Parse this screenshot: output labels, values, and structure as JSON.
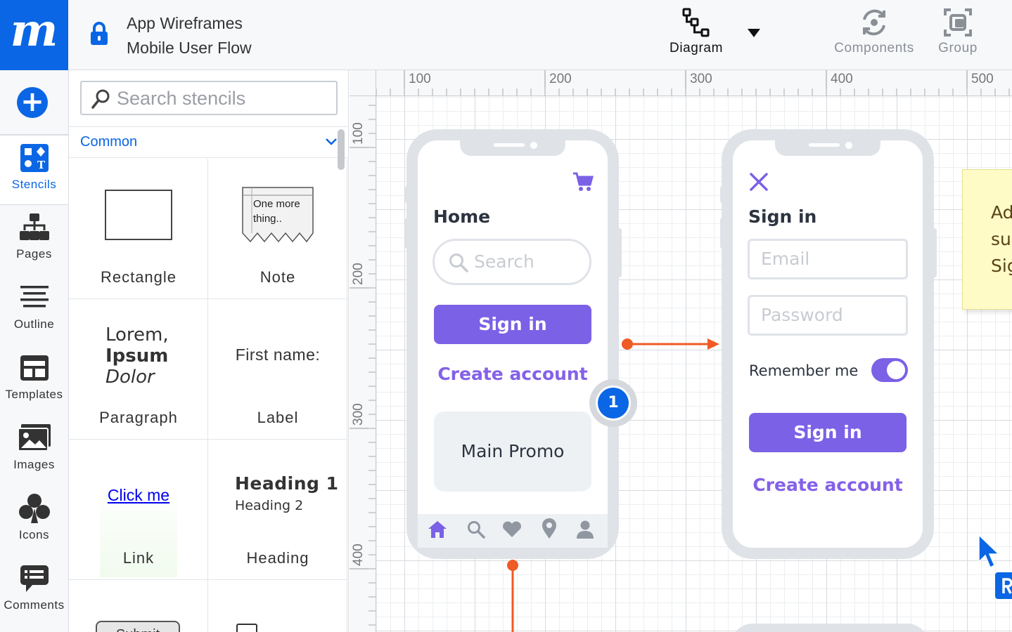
{
  "app": {
    "logo_letter": "m",
    "doc_title_line1": "App Wireframes",
    "doc_title_line2": "Mobile User Flow"
  },
  "toolbar": {
    "diagram": "Diagram",
    "components": "Components",
    "group": "Group"
  },
  "rail": {
    "add": "+",
    "items": [
      {
        "label": "Stencils",
        "icon": "stencils-icon",
        "active": true
      },
      {
        "label": "Pages",
        "icon": "pages-icon"
      },
      {
        "label": "Outline",
        "icon": "outline-icon"
      },
      {
        "label": "Templates",
        "icon": "templates-icon"
      },
      {
        "label": "Images",
        "icon": "images-icon"
      },
      {
        "label": "Icons",
        "icon": "club-icon"
      },
      {
        "label": "Comments",
        "icon": "comments-icon"
      }
    ]
  },
  "stencils": {
    "search_placeholder": "Search stencils",
    "section": "Common",
    "items": [
      {
        "label": "Rectangle"
      },
      {
        "label": "Note",
        "preview1": "One more",
        "preview2": "thing.."
      },
      {
        "label": "Paragraph",
        "preview1": "Lorem,",
        "preview2": "Ipsum",
        "preview3": "Dolor"
      },
      {
        "label": "Label",
        "preview": "First name:"
      },
      {
        "label": "Link",
        "preview": "Click me"
      },
      {
        "label": "Heading",
        "preview1": "Heading 1",
        "preview2": "Heading 2"
      }
    ],
    "partial_button": "Submit"
  },
  "rulers": {
    "top": [
      "100",
      "200",
      "300",
      "400",
      "500"
    ],
    "left": [
      "100",
      "200",
      "300",
      "400"
    ]
  },
  "home_screen": {
    "title": "Home",
    "search_placeholder": "Search",
    "sign_in": "Sign in",
    "create_account": "Create account",
    "promo": "Main Promo"
  },
  "signin_screen": {
    "title": "Sign in",
    "email_placeholder": "Email",
    "password_placeholder": "Password",
    "remember": "Remember me",
    "remember_on": true,
    "sign_in": "Sign in",
    "create_account": "Create account"
  },
  "badge": "1",
  "sticky_note": [
    "Ad",
    "sup",
    "Sig"
  ],
  "colors": {
    "brand": "#0a66e4",
    "accent_purple": "#7b61e6",
    "connector": "#f05a24"
  }
}
